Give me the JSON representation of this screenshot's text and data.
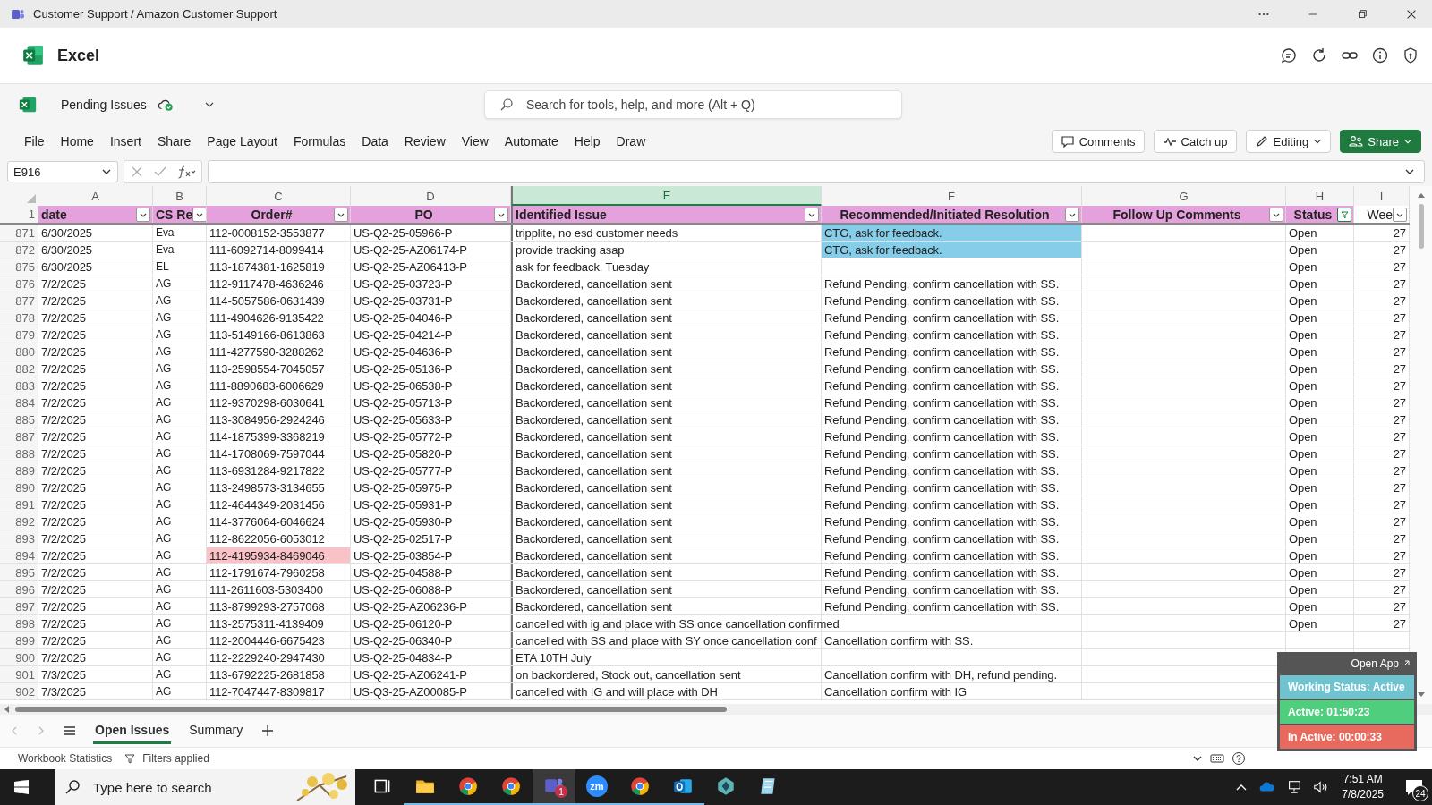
{
  "title_bar": {
    "title": "Customer Support / Amazon Customer Support"
  },
  "app": {
    "name": "Excel"
  },
  "file": {
    "name": "Pending Issues"
  },
  "search": {
    "placeholder": "Search for tools, help, and more (Alt + Q)"
  },
  "menu": [
    "File",
    "Home",
    "Insert",
    "Share",
    "Page Layout",
    "Formulas",
    "Data",
    "Review",
    "View",
    "Automate",
    "Help",
    "Draw"
  ],
  "actions": [
    {
      "kind": "comments",
      "label": "Comments"
    },
    {
      "kind": "catchup",
      "label": "Catch up"
    },
    {
      "kind": "editing",
      "label": "Editing"
    },
    {
      "kind": "share",
      "label": "Share"
    }
  ],
  "name_box": "E916",
  "column_letters": [
    {
      "letter": "A",
      "selected": false
    },
    {
      "letter": "B",
      "selected": false
    },
    {
      "letter": "C",
      "selected": false
    },
    {
      "letter": "D",
      "selected": false
    },
    {
      "letter": "E",
      "selected": true
    },
    {
      "letter": "F",
      "selected": false
    },
    {
      "letter": "G",
      "selected": false
    },
    {
      "letter": "H",
      "selected": false
    },
    {
      "letter": "I",
      "selected": false
    }
  ],
  "header_row": {
    "number": "1",
    "cells": [
      {
        "label": "date",
        "filtered": false
      },
      {
        "label": "CS Re",
        "filtered": false
      },
      {
        "label": "Order#",
        "filtered": false
      },
      {
        "label": "PO",
        "filtered": false
      },
      {
        "label": "Identified Issue",
        "filtered": false
      },
      {
        "label": "Recommended/Initiated Resolution",
        "filtered": false
      },
      {
        "label": "Follow Up Comments",
        "filtered": false
      },
      {
        "label": "Status",
        "filtered": true
      },
      {
        "label": "Wee",
        "filtered": false
      }
    ]
  },
  "rows": [
    {
      "n": "871",
      "date": "6/30/2025",
      "rep": "Eva",
      "order": "112-0008152-3553877",
      "po": "US-Q2-25-05966-P",
      "issue": "tripplite, no esd customer needs",
      "resolution": "CTG, ask for feedback.",
      "resolution_highlighted": true,
      "status": "Open",
      "week": "27"
    },
    {
      "n": "872",
      "date": "6/30/2025",
      "rep": "Eva",
      "order": "111-6092714-8099414",
      "po": "US-Q2-25-AZ06174-P",
      "issue": "provide tracking asap",
      "resolution": "CTG, ask for feedback.",
      "resolution_highlighted": true,
      "status": "Open",
      "week": "27"
    },
    {
      "n": "875",
      "date": "6/30/2025",
      "rep": "EL",
      "order": "113-1874381-1625819",
      "po": "US-Q2-25-AZ06413-P",
      "issue": "ask for feedback. Tuesday",
      "status": "Open",
      "week": "27"
    },
    {
      "n": "876",
      "date": "7/2/2025",
      "rep": "AG",
      "order": "112-9117478-4636246",
      "po": "US-Q2-25-03723-P",
      "issue": "Backordered, cancellation sent",
      "resolution": "Refund Pending, confirm cancellation with SS.",
      "status": "Open",
      "week": "27"
    },
    {
      "n": "877",
      "date": "7/2/2025",
      "rep": "AG",
      "order": "114-5057586-0631439",
      "po": "US-Q2-25-03731-P",
      "issue": "Backordered, cancellation sent",
      "resolution": "Refund Pending, confirm cancellation with SS.",
      "status": "Open",
      "week": "27"
    },
    {
      "n": "878",
      "date": "7/2/2025",
      "rep": "AG",
      "order": "111-4904626-9135422",
      "po": "US-Q2-25-04046-P",
      "issue": "Backordered, cancellation sent",
      "resolution": "Refund Pending, confirm cancellation with SS.",
      "status": "Open",
      "week": "27"
    },
    {
      "n": "879",
      "date": "7/2/2025",
      "rep": "AG",
      "order": "113-5149166-8613863",
      "po": "US-Q2-25-04214-P",
      "issue": "Backordered, cancellation sent",
      "resolution": "Refund Pending, confirm cancellation with SS.",
      "status": "Open",
      "week": "27"
    },
    {
      "n": "880",
      "date": "7/2/2025",
      "rep": "AG",
      "order": "111-4277590-3288262",
      "po": "US-Q2-25-04636-P",
      "issue": "Backordered, cancellation sent",
      "resolution": "Refund Pending, confirm cancellation with SS.",
      "status": "Open",
      "week": "27"
    },
    {
      "n": "882",
      "date": "7/2/2025",
      "rep": "AG",
      "order": "113-2598554-7045057",
      "po": "US-Q2-25-05136-P",
      "issue": "Backordered, cancellation sent",
      "resolution": "Refund Pending, confirm cancellation with SS.",
      "status": "Open",
      "week": "27"
    },
    {
      "n": "883",
      "date": "7/2/2025",
      "rep": "AG",
      "order": "111-8890683-6006629",
      "po": "US-Q2-25-06538-P",
      "issue": "Backordered, cancellation sent",
      "resolution": "Refund Pending, confirm cancellation with SS.",
      "status": "Open",
      "week": "27"
    },
    {
      "n": "884",
      "date": "7/2/2025",
      "rep": "AG",
      "order": "112-9370298-6030641",
      "po": "US-Q2-25-05713-P",
      "issue": "Backordered, cancellation sent",
      "resolution": "Refund Pending, confirm cancellation with SS.",
      "status": "Open",
      "week": "27"
    },
    {
      "n": "885",
      "date": "7/2/2025",
      "rep": "AG",
      "order": "113-3084956-2924246",
      "po": "US-Q2-25-05633-P",
      "issue": "Backordered, cancellation sent",
      "resolution": "Refund Pending, confirm cancellation with SS.",
      "status": "Open",
      "week": "27"
    },
    {
      "n": "887",
      "date": "7/2/2025",
      "rep": "AG",
      "order": "114-1875399-3368219",
      "po": "US-Q2-25-05772-P",
      "issue": "Backordered, cancellation sent",
      "resolution": "Refund Pending, confirm cancellation with SS.",
      "status": "Open",
      "week": "27"
    },
    {
      "n": "888",
      "date": "7/2/2025",
      "rep": "AG",
      "order": "114-1708069-7597044",
      "po": "US-Q2-25-05820-P",
      "issue": "Backordered, cancellation sent",
      "resolution": "Refund Pending, confirm cancellation with SS.",
      "status": "Open",
      "week": "27"
    },
    {
      "n": "889",
      "date": "7/2/2025",
      "rep": "AG",
      "order": "113-6931284-9217822",
      "po": "US-Q2-25-05777-P",
      "issue": "Backordered, cancellation sent",
      "resolution": "Refund Pending, confirm cancellation with SS.",
      "status": "Open",
      "week": "27"
    },
    {
      "n": "890",
      "date": "7/2/2025",
      "rep": "AG",
      "order": "113-2498573-3134655",
      "po": "US-Q2-25-05975-P",
      "issue": "Backordered, cancellation sent",
      "resolution": "Refund Pending, confirm cancellation with SS.",
      "status": "Open",
      "week": "27"
    },
    {
      "n": "891",
      "date": "7/2/2025",
      "rep": "AG",
      "order": "112-4644349-2031456",
      "po": "US-Q2-25-05931-P",
      "issue": "Backordered, cancellation sent",
      "resolution": "Refund Pending, confirm cancellation with SS.",
      "status": "Open",
      "week": "27"
    },
    {
      "n": "892",
      "date": "7/2/2025",
      "rep": "AG",
      "order": "114-3776064-6046624",
      "po": "US-Q2-25-05930-P",
      "issue": "Backordered, cancellation sent",
      "resolution": "Refund Pending, confirm cancellation with SS.",
      "status": "Open",
      "week": "27"
    },
    {
      "n": "893",
      "date": "7/2/2025",
      "rep": "AG",
      "order": "112-8622056-6053012",
      "po": "US-Q2-25-02517-P",
      "issue": "Backordered, cancellation sent",
      "resolution": "Refund Pending, confirm cancellation with SS.",
      "status": "Open",
      "week": "27"
    },
    {
      "n": "894",
      "date": "7/2/2025",
      "rep": "AG",
      "order": "112-4195934-8469046",
      "order_highlighted": true,
      "po": "US-Q2-25-03854-P",
      "issue": "Backordered, cancellation sent",
      "resolution": "Refund Pending, confirm cancellation with SS.",
      "status": "Open",
      "week": "27"
    },
    {
      "n": "895",
      "date": "7/2/2025",
      "rep": "AG",
      "order": "112-1791674-7960258",
      "po": "US-Q2-25-04588-P",
      "issue": "Backordered, cancellation sent",
      "resolution": "Refund Pending, confirm cancellation with SS.",
      "status": "Open",
      "week": "27"
    },
    {
      "n": "896",
      "date": "7/2/2025",
      "rep": "AG",
      "order": "111-2611603-5303400",
      "po": "US-Q2-25-06088-P",
      "issue": "Backordered, cancellation sent",
      "resolution": "Refund Pending, confirm cancellation with SS.",
      "status": "Open",
      "week": "27"
    },
    {
      "n": "897",
      "date": "7/2/2025",
      "rep": "AG",
      "order": "113-8799293-2757068",
      "po": "US-Q2-25-AZ06236-P",
      "issue": "Backordered, cancellation sent",
      "resolution": "Refund Pending, confirm cancellation with SS.",
      "status": "Open",
      "week": "27"
    },
    {
      "n": "898",
      "date": "7/2/2025",
      "rep": "AG",
      "order": "113-2575311-4139409",
      "po": "US-Q2-25-06120-P",
      "issue": "cancelled with ig and place with SS once cancellation confirmed",
      "status": "Open",
      "week": "27"
    },
    {
      "n": "899",
      "date": "7/2/2025",
      "rep": "AG",
      "order": "112-2004446-6675423",
      "po": "US-Q2-25-06340-P",
      "issue": "cancelled with SS and place with SY once cancellation conf",
      "resolution": "Cancellation confirm with SS."
    },
    {
      "n": "900",
      "date": "7/2/2025",
      "rep": "AG",
      "order": "112-2229240-2947430",
      "po": "US-Q2-25-04834-P",
      "issue": "ETA 10TH July"
    },
    {
      "n": "901",
      "date": "7/3/2025",
      "rep": "AG",
      "order": "113-6792225-2681858",
      "po": "US-Q2-25-AZ06241-P",
      "issue": "on backordered, Stock out, cancellation sent",
      "resolution": "Cancellation confirm with DH, refund pending."
    },
    {
      "n": "902",
      "date": "7/3/2025",
      "rep": "AG",
      "order": "112-7047447-8309817",
      "po": "US-Q3-25-AZ00085-P",
      "issue": "cancelled with IG and will place with DH",
      "resolution": "Cancellation confirm with IG"
    }
  ],
  "sheet_tabs": [
    {
      "label": "Open Issues",
      "selected": true
    },
    {
      "label": "Summary",
      "selected": false
    }
  ],
  "status_bar": {
    "statistics": "Workbook Statistics",
    "filters": "Filters applied"
  },
  "tracker": {
    "link": "Open App",
    "status": "Working Status: Active",
    "active": "Active: 01:50:23",
    "inactive": "In Active: 00:00:33"
  },
  "taskbar": {
    "search_placeholder": "Type here to search",
    "apps": [
      {
        "kind": "taskview",
        "running": false
      },
      {
        "kind": "folder",
        "running": true
      },
      {
        "kind": "chrome",
        "running": true
      },
      {
        "kind": "chrome",
        "running": true
      },
      {
        "kind": "teams",
        "running": true,
        "selected": true,
        "badge": "1"
      },
      {
        "kind": "zoom",
        "running": true,
        "label": "zm"
      },
      {
        "kind": "chrome",
        "running": true
      },
      {
        "kind": "outlook",
        "running": true
      },
      {
        "kind": "diamond",
        "running": false
      },
      {
        "kind": "notepad",
        "running": false
      }
    ],
    "time": "7:51 AM",
    "date": "7/8/2025",
    "notifications": "24"
  }
}
